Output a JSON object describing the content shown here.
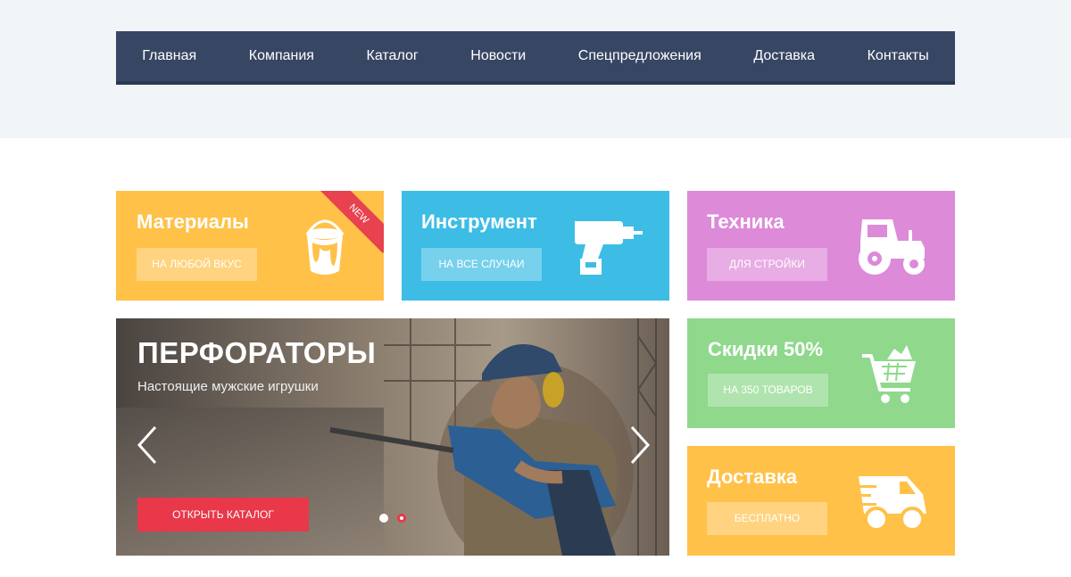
{
  "nav": {
    "items": [
      "Главная",
      "Компания",
      "Каталог",
      "Новости",
      "Спецпредложения",
      "Доставка",
      "Контакты"
    ]
  },
  "tiles": {
    "materials": {
      "title": "Материалы",
      "button": "НА ЛЮБОЙ ВКУС",
      "badge": "NEW",
      "color": "#ffc148",
      "icon": "paint-bucket-icon"
    },
    "tools": {
      "title": "Инструмент",
      "button": "НА ВСЕ СЛУЧАИ",
      "color": "#3dbde5",
      "icon": "drill-icon"
    },
    "machinery": {
      "title": "Техника",
      "button": "ДЛЯ СТРОЙКИ",
      "color": "#dd8ad9",
      "icon": "tractor-icon"
    },
    "sale": {
      "title": "Скидки 50%",
      "button": "НА 350 ТОВАРОВ",
      "color": "#8fd88c",
      "icon": "shopping-cart-icon"
    },
    "delivery": {
      "title": "Доставка",
      "button": "БЕСПЛАТНО",
      "color": "#ffc148",
      "icon": "delivery-truck-icon"
    }
  },
  "hero": {
    "title": "ПЕРФОРАТОРЫ",
    "subtitle": "Настоящие мужские игрушки",
    "button": "ОТКРЫТЬ КАТАЛОГ",
    "accent": "#e8384a",
    "slides_total": 2,
    "active_slide": 2
  }
}
